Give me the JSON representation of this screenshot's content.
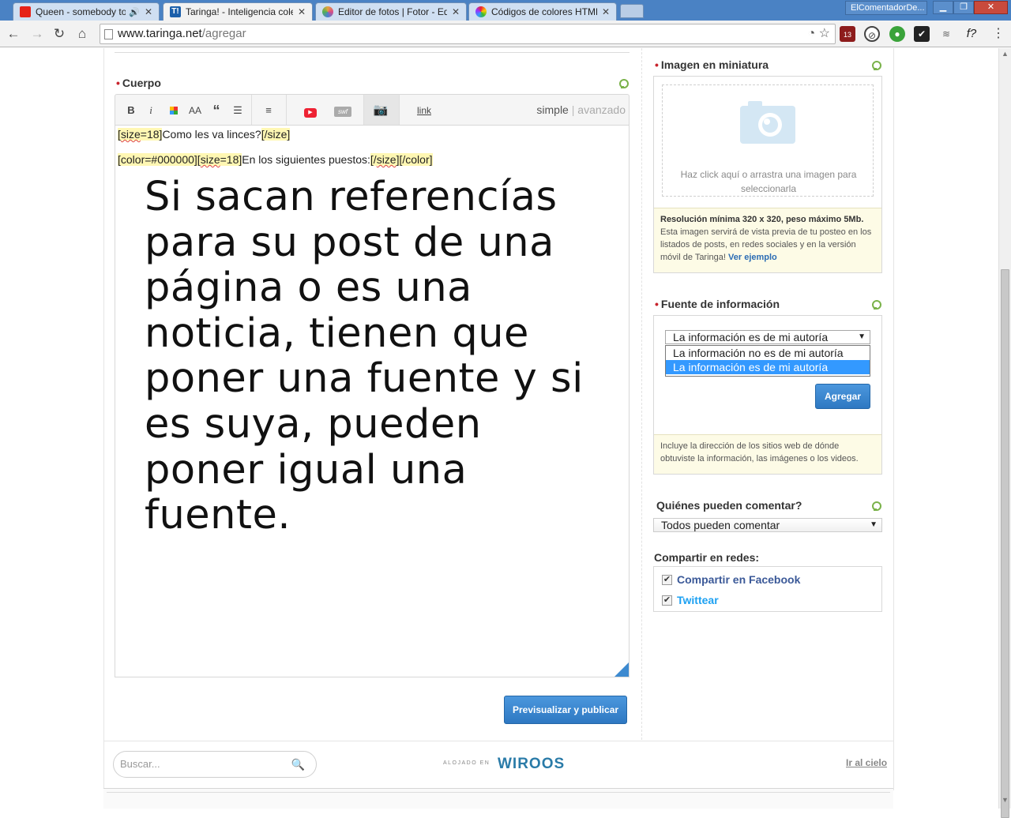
{
  "browser": {
    "tabs": [
      {
        "label": "Queen - somebody to",
        "icon_color": "#e62117",
        "active": false
      },
      {
        "label": "Taringa! - Inteligencia cole",
        "icon_color": "#1b5faa",
        "active": true
      },
      {
        "label": "Editor de fotos | Fotor - Ed",
        "icon_color": "#e8a33a",
        "active": false
      },
      {
        "label": "Códigos de colores HTML",
        "icon_color": "#3b9b3b",
        "active": false
      }
    ],
    "profile": "ElComentadorDe...",
    "url_host": "www.taringa.net",
    "url_path": "/agregar",
    "ext_badge": "13"
  },
  "post": {
    "body_label": "Cuerpo",
    "toolbar": {
      "bold": "B",
      "italic": "i",
      "size": "AA",
      "quote": "“",
      "link": "link",
      "swf": "swf",
      "mode_simple": "simple",
      "mode_pipe": "|",
      "mode_advanced": "avanzado"
    },
    "line1": {
      "open": "[",
      "tag1": "size",
      "eq": "=18]",
      "text": "Como les va linces?",
      "close": "[/size]"
    },
    "line2": {
      "open": "[color=#000000][",
      "tag1": "size",
      "eq": "=18]",
      "text": "En los siguientes puestos:",
      "close1": "[/",
      "tag2": "size",
      "close2": "][/color]"
    },
    "big_text": "Si sacan referencías para su post de una página o es una noticia, tienen que poner una fuente y si es suya, pueden poner igual una fuente.",
    "publish_button": "Previsualizar y publicar"
  },
  "sidebar": {
    "thumbnail": {
      "title": "Imagen en miniatura",
      "drop_text": "Haz click aquí o arrastra una imagen para seleccionarla",
      "note_bold": "Resolución mínima 320 x 320, peso máximo 5Mb.",
      "note_text": "Esta imagen servirá de vista previa de tu posteo en los listados de posts, en redes sociales y en la versión móvil de Taringa!",
      "note_link": "Ver ejemplo"
    },
    "source": {
      "title": "Fuente de información",
      "selected": "La información es de mi autoría",
      "options": [
        "La información no es de mi autoría",
        "La información es de mi autoría"
      ],
      "add_button": "Agregar",
      "note": "Incluye la dirección de los sitios web de dónde obtuviste la información, las imágenes o los videos."
    },
    "comments": {
      "title": "Quiénes pueden comentar?",
      "selected": "Todos pueden comentar"
    },
    "share": {
      "title": "Compartir en redes:",
      "facebook": "Compartir en Facebook",
      "twitter": "Twittear",
      "facebook_color": "#3b5998",
      "twitter_color": "#1da1f2"
    }
  },
  "footer": {
    "search_placeholder": "Buscar...",
    "hosted_label": "ALOJADO EN",
    "host_brand": "WIROOS",
    "to_top": "Ir al cielo"
  }
}
